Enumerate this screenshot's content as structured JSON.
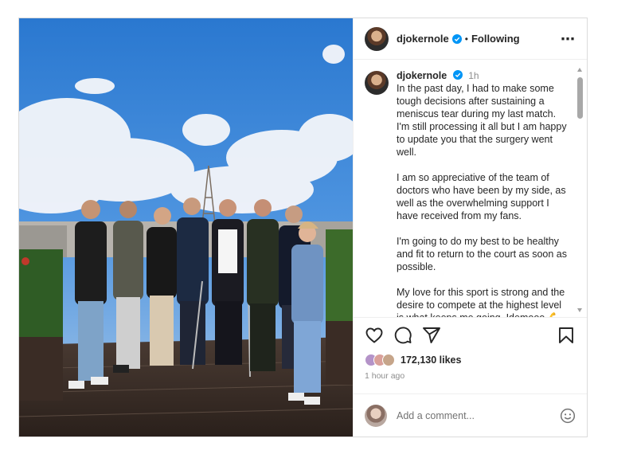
{
  "header": {
    "username": "djokernole",
    "separator": "•",
    "follow_status": "Following",
    "more_icon": "⋯"
  },
  "caption": {
    "username": "djokernole",
    "time": "1h",
    "paragraphs": [
      "In the past day, I had to make some tough decisions after sustaining a meniscus tear during my last match. I'm still processing it all but I am happy to update you that the surgery went well.",
      "I am so appreciative of the team of doctors who have been by my side, as well as the overwhelming support I have received from my fans.",
      "I'm going to do my best to be healthy and fit to return to the court as soon as possible.",
      "My love for this sport is strong and the desire to compete at the highest level is what keeps me going. Idemooo 💪💪"
    ]
  },
  "actions": {
    "icons": [
      "heart-icon",
      "comment-icon",
      "share-icon",
      "bookmark-icon"
    ]
  },
  "likes": {
    "count_text": "172,130 likes"
  },
  "timestamp": "1 hour ago",
  "comment_box": {
    "placeholder": "Add a comment..."
  },
  "colors": {
    "verified": "#0095f6",
    "muted": "#8e8e8e",
    "border": "#dbdbdb"
  }
}
